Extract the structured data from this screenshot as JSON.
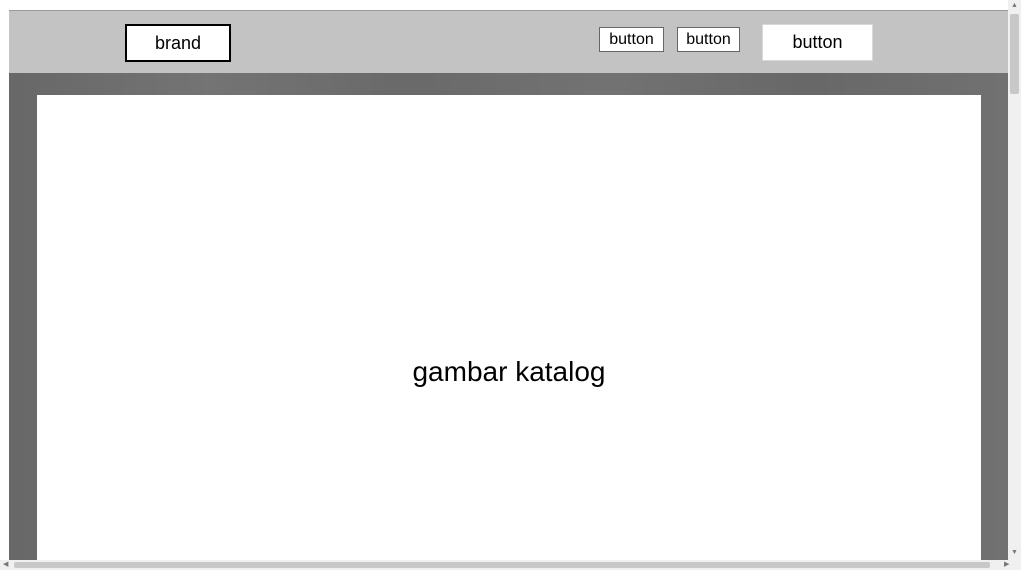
{
  "navbar": {
    "brand_label": "brand",
    "buttons": [
      {
        "label": "button"
      },
      {
        "label": "button"
      },
      {
        "label": "button"
      }
    ]
  },
  "hero": {
    "catalog_label": "gambar katalog"
  },
  "colors": {
    "navbar_bg": "#c3c3c3",
    "hero_bg": "#6f6f6f",
    "catalog_bg": "#ffffff"
  },
  "icons": {
    "scroll_up": "scroll-up-arrow-icon",
    "scroll_down": "scroll-down-arrow-icon",
    "scroll_left": "scroll-left-arrow-icon",
    "scroll_right": "scroll-right-arrow-icon"
  }
}
